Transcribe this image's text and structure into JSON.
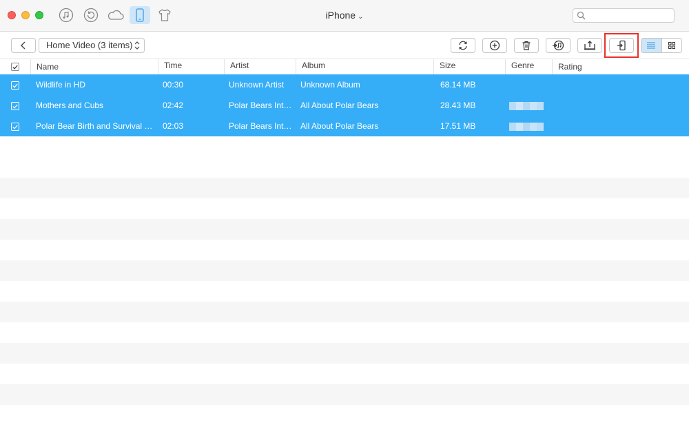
{
  "window": {
    "title": "iPhone",
    "search": {
      "placeholder": ""
    }
  },
  "nav": {
    "items": [
      {
        "icon": "music-icon",
        "active": false
      },
      {
        "icon": "restore-icon",
        "active": false
      },
      {
        "icon": "cloud-icon",
        "active": false
      },
      {
        "icon": "phone-icon",
        "active": true
      },
      {
        "icon": "shirt-icon",
        "active": false
      }
    ]
  },
  "toolbar": {
    "category": "Home Video (3 items)",
    "buttons": [
      "refresh-icon",
      "add-icon",
      "delete-icon",
      "to-itunes-icon",
      "to-computer-icon",
      "to-device-icon"
    ],
    "view_modes": [
      "list-view-icon",
      "grid-view-icon"
    ]
  },
  "table": {
    "columns": {
      "name": "Name",
      "time": "Time",
      "artist": "Artist",
      "album": "Album",
      "size": "Size",
      "genre": "Genre",
      "rating": "Rating"
    },
    "rows": [
      {
        "name": "Wildlife in HD",
        "time": "00:30",
        "artist": "Unknown Artist",
        "album": "Unknown Album",
        "size": "68.14 MB"
      },
      {
        "name": "Mothers and Cubs",
        "time": "02:42",
        "artist": "Polar Bears Inte…",
        "album": "All About Polar Bears",
        "size": "28.43 MB"
      },
      {
        "name": "Polar Bear Birth and Survival R…",
        "time": "02:03",
        "artist": "Polar Bears Inte…",
        "album": "All About Polar Bears",
        "size": "17.51 MB"
      }
    ]
  },
  "colors": {
    "selection": "#36adf7",
    "highlight_box": "#e8312a",
    "active_tab": "#cfe6f8"
  }
}
